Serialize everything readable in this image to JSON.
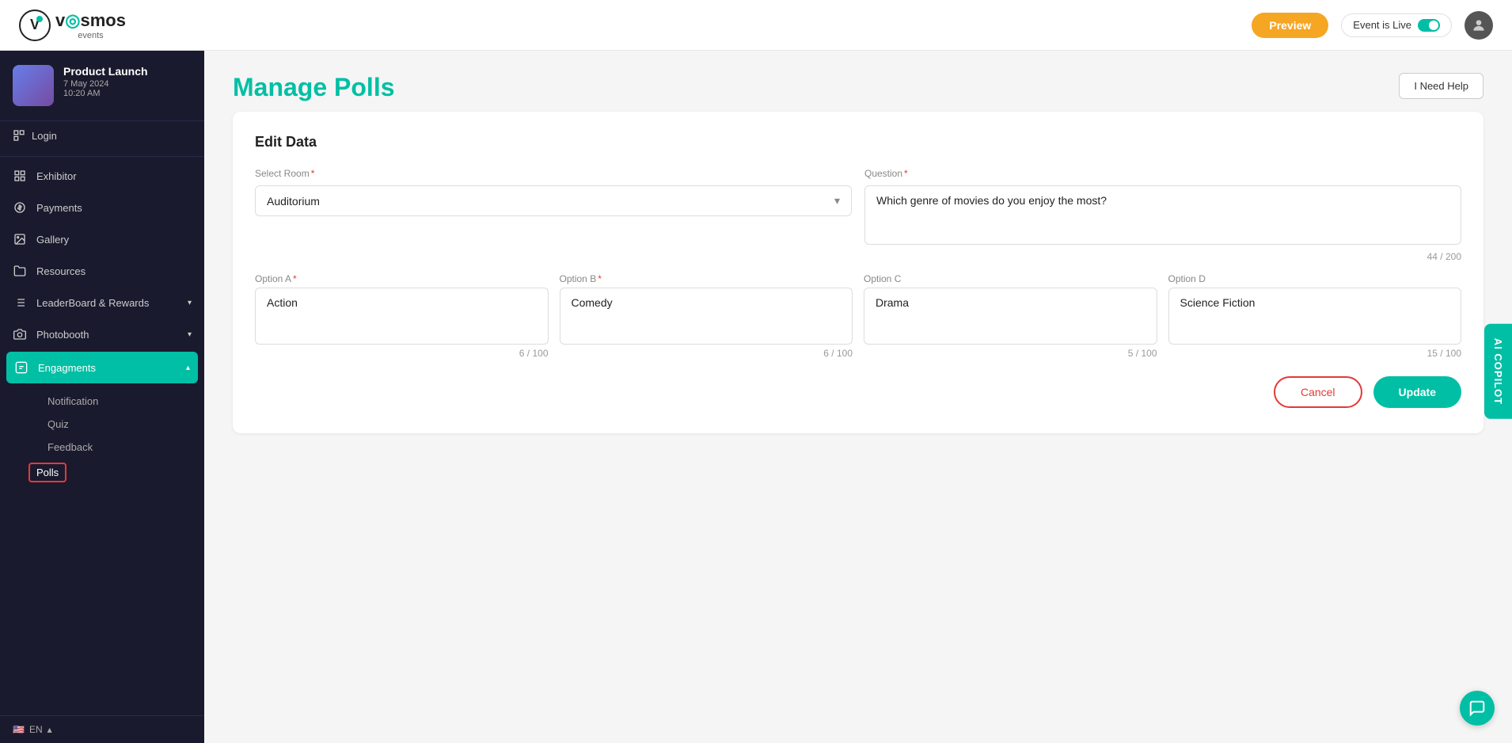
{
  "app": {
    "name": "Vosmos Events"
  },
  "topNav": {
    "preview_label": "Preview",
    "event_live_label": "Event is Live",
    "help_label": "I Need Help"
  },
  "sidebar": {
    "event": {
      "name": "Product Launch",
      "date": "7 May 2024",
      "time": "10:20 AM"
    },
    "login_label": "Login",
    "items": [
      {
        "id": "exhibitor",
        "label": "Exhibitor",
        "icon": "grid"
      },
      {
        "id": "payments",
        "label": "Payments",
        "icon": "dollar"
      },
      {
        "id": "gallery",
        "label": "Gallery",
        "icon": "image"
      },
      {
        "id": "resources",
        "label": "Resources",
        "icon": "folder"
      },
      {
        "id": "leaderboard",
        "label": "LeaderBoard & Rewards",
        "icon": "trophy",
        "has_arrow": true
      },
      {
        "id": "photobooth",
        "label": "Photobooth",
        "icon": "camera",
        "has_arrow": true
      },
      {
        "id": "engagements",
        "label": "Engagments",
        "icon": "engagement",
        "has_arrow": true,
        "active": true
      }
    ],
    "sub_items": [
      {
        "id": "notification",
        "label": "Notification"
      },
      {
        "id": "quiz",
        "label": "Quiz"
      },
      {
        "id": "feedback",
        "label": "Feedback"
      },
      {
        "id": "polls",
        "label": "Polls",
        "active": true
      }
    ],
    "lang": {
      "code": "EN",
      "flag": "🇺🇸"
    }
  },
  "page": {
    "title": "Manage Polls",
    "edit_section_title": "Edit Data",
    "select_room_label": "Select Room",
    "select_room_value": "Auditorium",
    "question_label": "Question",
    "question_value": "Which genre of movies do you enjoy the most?",
    "question_char_count": "44 / 200",
    "options": [
      {
        "id": "A",
        "label": "Option A",
        "value": "Action",
        "char_count": "6 / 100",
        "required": true
      },
      {
        "id": "B",
        "label": "Option B",
        "value": "Comedy",
        "char_count": "6 / 100",
        "required": true
      },
      {
        "id": "C",
        "label": "Option C",
        "value": "Drama",
        "char_count": "5 / 100",
        "required": false
      },
      {
        "id": "D",
        "label": "Option D",
        "value": "Science Fiction",
        "char_count": "15 / 100",
        "required": false
      }
    ],
    "cancel_label": "Cancel",
    "update_label": "Update"
  },
  "aiCopilot": {
    "label": "AI COPILOT"
  }
}
